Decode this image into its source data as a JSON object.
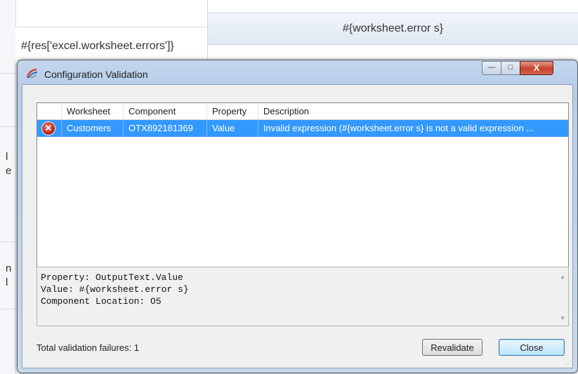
{
  "background": {
    "cell_left_text": "#{res['excel.worksheet.errors']}",
    "cell_right_text": "#{worksheet.error s}",
    "left_fragments": [
      "l",
      "e",
      "n",
      "l"
    ]
  },
  "window": {
    "title": "Configuration Validation",
    "controls": {
      "minimize": "—",
      "maximize": "□",
      "close": "X"
    }
  },
  "grid": {
    "columns": [
      "Worksheet",
      "Component",
      "Property",
      "Description"
    ],
    "rows": [
      {
        "status_icon": "error-icon",
        "worksheet": "Customers",
        "component": "OTX892181369",
        "property": "Value",
        "description": "Invalid expression (#{worksheet.error s} is not a valid expression ..."
      }
    ]
  },
  "details": {
    "lines": [
      "Property: OutputText.Value",
      "Value: #{worksheet.error s}",
      "Component Location: O5"
    ]
  },
  "footer": {
    "total": "Total validation failures: 1",
    "revalidate_label": "Revalidate",
    "close_label": "Close"
  },
  "colors": {
    "selection": "#3399ff",
    "error_icon": "#c0281a",
    "title_bar": "#b7cde8"
  }
}
